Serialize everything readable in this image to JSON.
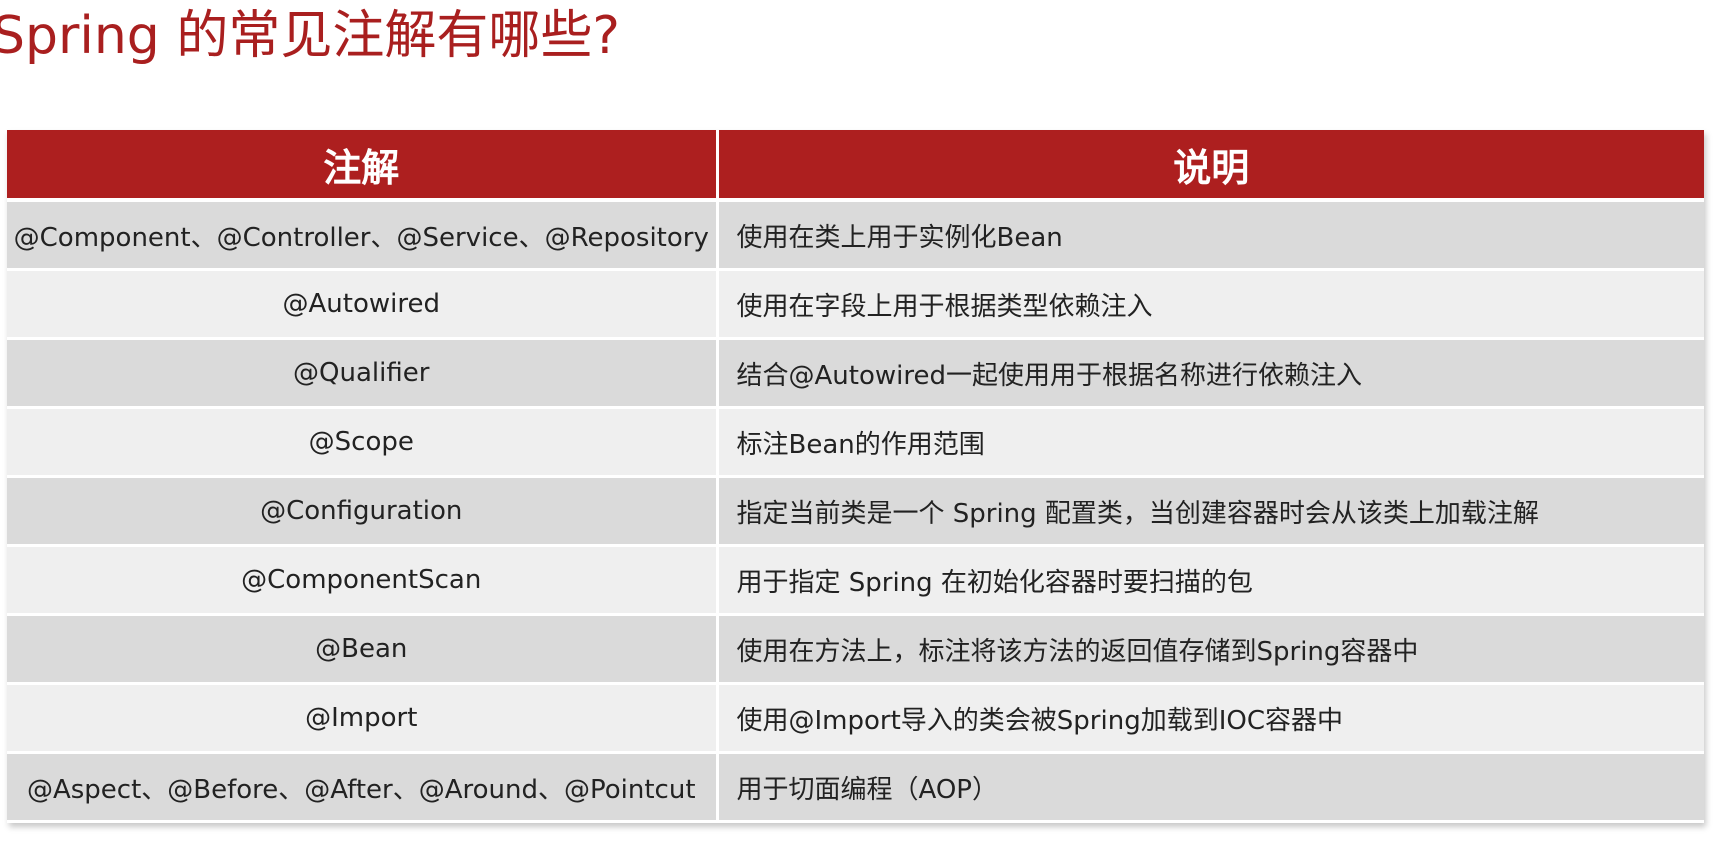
{
  "title": "Spring 的常见注解有哪些?",
  "colors": {
    "title": "#a91f1f",
    "header_bg": "#ad1f1f",
    "header_text": "#ffffff",
    "row_odd_bg": "#dadada",
    "row_even_bg": "#efefef"
  },
  "table": {
    "headers": [
      "注解",
      "说明"
    ],
    "rows": [
      {
        "annotation": "@Component、@Controller、@Service、@Repository",
        "description": "使用在类上用于实例化Bean"
      },
      {
        "annotation": "@Autowired",
        "description": "使用在字段上用于根据类型依赖注入"
      },
      {
        "annotation": "@Qualifier",
        "description": "结合@Autowired一起使用用于根据名称进行依赖注入"
      },
      {
        "annotation": "@Scope",
        "description": "标注Bean的作用范围"
      },
      {
        "annotation": "@Configuration",
        "description": "指定当前类是一个 Spring 配置类，当创建容器时会从该类上加载注解"
      },
      {
        "annotation": "@ComponentScan",
        "description": "用于指定 Spring  在初始化容器时要扫描的包"
      },
      {
        "annotation": "@Bean",
        "description": "使用在方法上，标注将该方法的返回值存储到Spring容器中"
      },
      {
        "annotation": "@Import",
        "description": "使用@Import导入的类会被Spring加载到IOC容器中"
      },
      {
        "annotation": "@Aspect、@Before、@After、@Around、@Pointcut",
        "description": "用于切面编程（AOP）"
      }
    ]
  }
}
